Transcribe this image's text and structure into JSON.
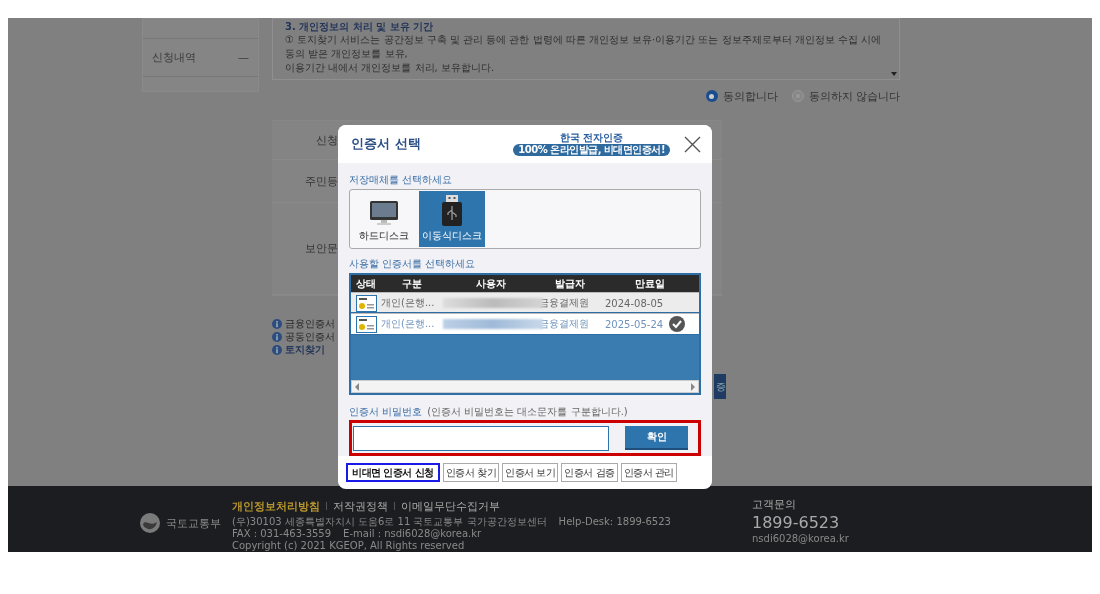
{
  "sidebar": {
    "items": [
      {
        "label": "신청내역",
        "marker": "—"
      }
    ]
  },
  "terms": {
    "heading": "3. 개인정보의 처리 및 보유 기간",
    "lines": [
      "① 토지찾기 서비스는 공간정보 구축 및 관리 등에 관한 법령에 따른 개인정보 보유·이용기간 또는 정보주체로부터 개인정보 수집 시에 동의 받은 개인정보를 보유,",
      "이용기간 내에서 개인정보를 처리, 보유합니다."
    ]
  },
  "consent": [
    {
      "label": "동의합니다",
      "selected": true
    },
    {
      "label": "동의하지 않습니다",
      "selected": false
    }
  ],
  "form": {
    "labels": [
      "신청",
      "주민등",
      "보안문"
    ]
  },
  "notices": [
    {
      "text": "금융인증서",
      "emphasis": false
    },
    {
      "text": "공동인증서",
      "emphasis": false
    },
    {
      "text": "토지찾기",
      "emphasis": true
    }
  ],
  "action_button": {
    "label": "증"
  },
  "dialog": {
    "title": "인증서 선택",
    "brand": {
      "name": "한국 전자인증",
      "slogan": "100% 온라인발급, 비대면인증서!"
    },
    "media_label": "저장매체를 선택하세요",
    "media": [
      {
        "label": "하드디스크",
        "kind": "harddisk",
        "selected": false
      },
      {
        "label": "이동식디스크",
        "kind": "usb",
        "selected": true
      }
    ],
    "cert_label": "사용할 인증서를 선택하세요",
    "table": {
      "columns": [
        "상태",
        "구분",
        "사용자",
        "발급자",
        "만료일"
      ],
      "rows": [
        {
          "type": "개인(은행...",
          "issuer": "금융결제원",
          "expiry": "2024-08-05",
          "selected": false
        },
        {
          "type": "개인(은행...",
          "issuer": "금융결제원",
          "expiry": "2025-05-24",
          "selected": true
        }
      ]
    },
    "password": {
      "label": "인증서 비밀번호",
      "hint": "(인증서 비밀번호는 대소문자를 구분합니다.)"
    },
    "confirm": "확인",
    "buttons": [
      {
        "label": "비대면 인증서 신청",
        "kind": "primary"
      },
      {
        "label": "인증서 찾기",
        "kind": "plain"
      },
      {
        "label": "인증서 보기",
        "kind": "plain"
      },
      {
        "label": "인증서 검증",
        "kind": "plain"
      },
      {
        "label": "인증서 관리",
        "kind": "plain"
      }
    ]
  },
  "footer": {
    "org": "국토교통부",
    "links": [
      {
        "label": "개인정보처리방침",
        "highlight": true
      },
      {
        "label": "저작권정책",
        "highlight": false
      },
      {
        "label": "이메일무단수집거부",
        "highlight": false
      }
    ],
    "address": [
      "(우)30103 세종특별자치시 도움6로 11 국토교통부 국가공간정보센터",
      "Help-Desk: 1899-6523",
      "FAX : 031-463-3559",
      "E-mail : nsdi6028@korea.kr"
    ],
    "copyright": "Copyright (c) 2021 KGEOP, All Rights reserved",
    "contact": {
      "label": "고객문의",
      "phone": "1899-6523",
      "email": "nsdi6028@korea.kr"
    }
  }
}
